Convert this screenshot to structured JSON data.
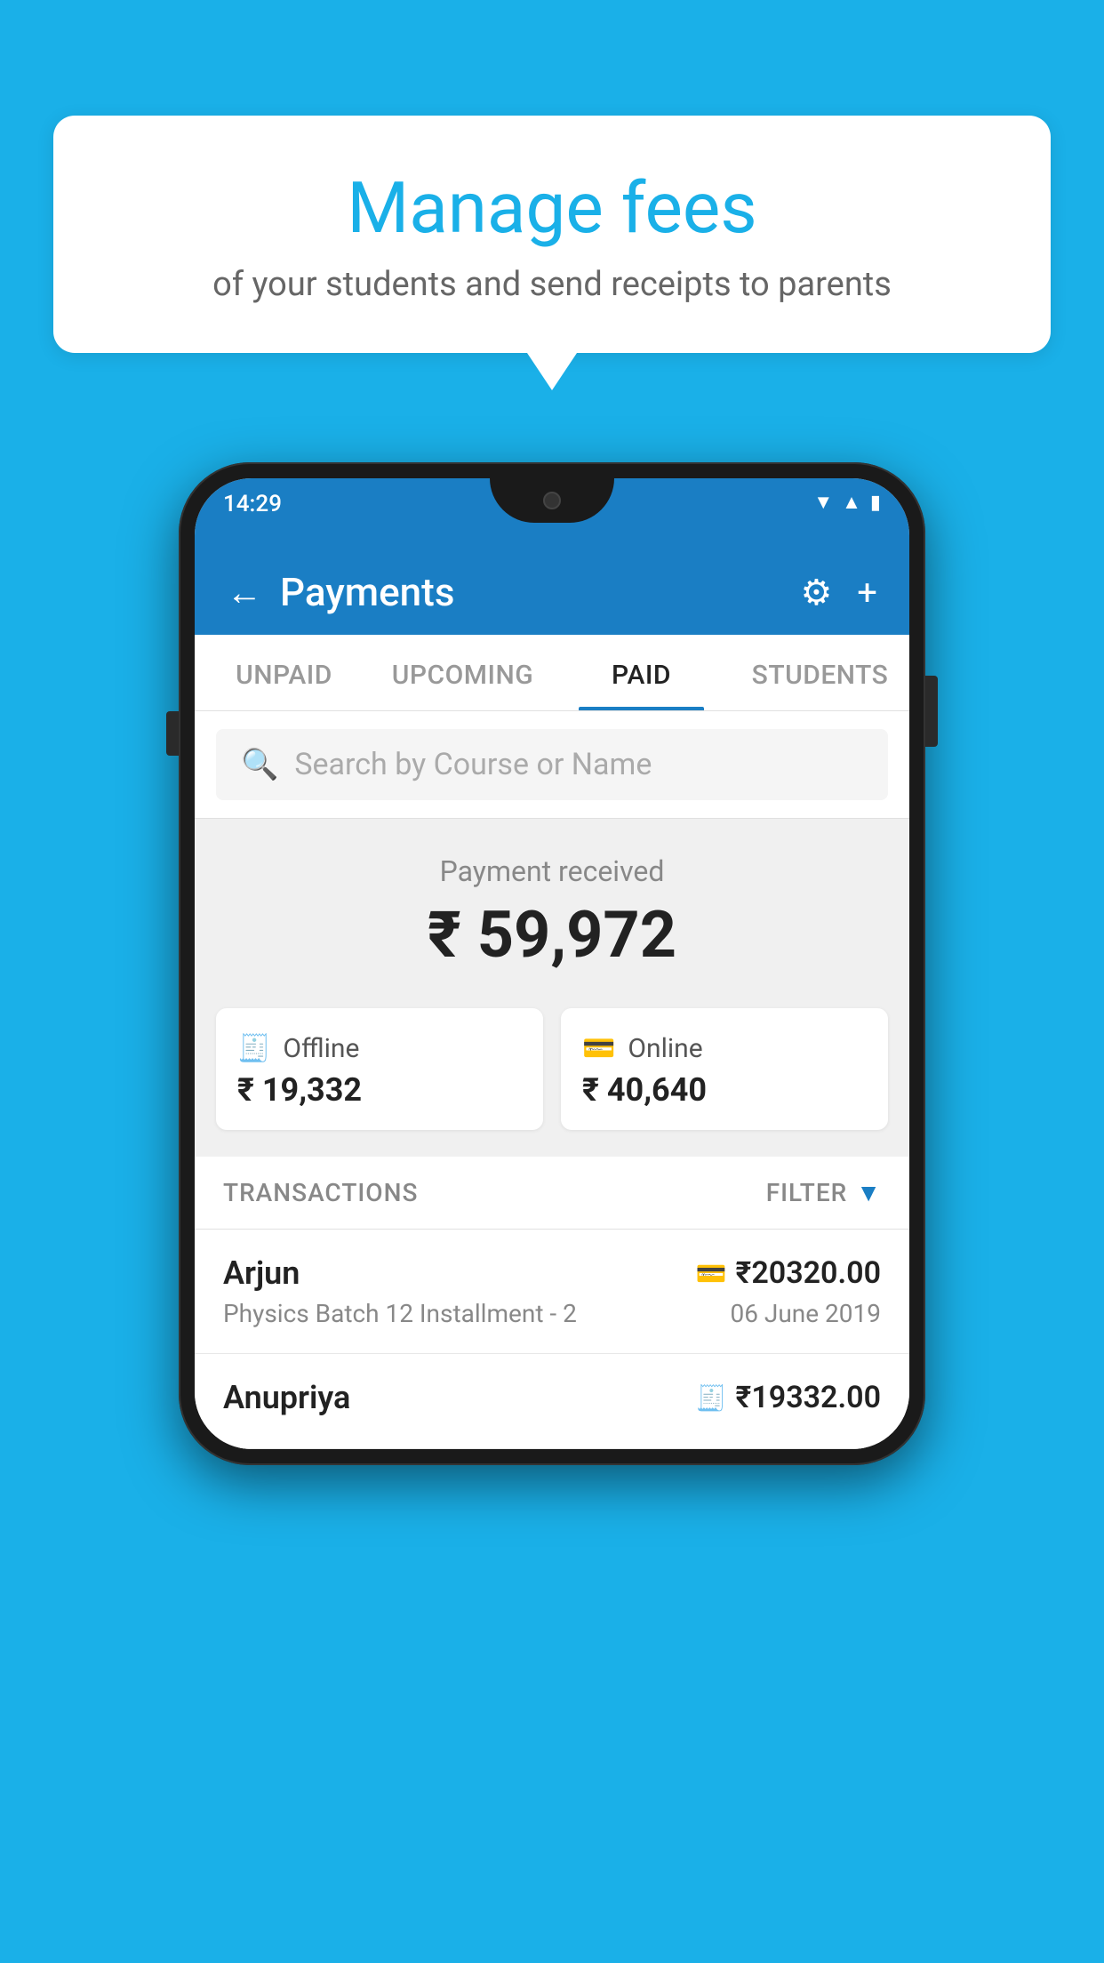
{
  "background_color": "#1ab0e8",
  "speech_bubble": {
    "title": "Manage fees",
    "subtitle": "of your students and send receipts to parents"
  },
  "phone": {
    "status_bar": {
      "time": "14:29"
    },
    "header": {
      "title": "Payments",
      "back_label": "←",
      "settings_icon": "⚙",
      "add_icon": "+"
    },
    "tabs": [
      {
        "label": "UNPAID",
        "active": false
      },
      {
        "label": "UPCOMING",
        "active": false
      },
      {
        "label": "PAID",
        "active": true
      },
      {
        "label": "STUDENTS",
        "active": false
      }
    ],
    "search": {
      "placeholder": "Search by Course or Name"
    },
    "payment_received": {
      "label": "Payment received",
      "amount": "₹ 59,972",
      "cards": [
        {
          "icon": "🧾",
          "type": "Offline",
          "amount": "₹ 19,332"
        },
        {
          "icon": "💳",
          "type": "Online",
          "amount": "₹ 40,640"
        }
      ]
    },
    "transactions": {
      "section_label": "TRANSACTIONS",
      "filter_label": "FILTER",
      "items": [
        {
          "name": "Arjun",
          "payment_mode_icon": "💳",
          "amount": "₹20320.00",
          "course": "Physics Batch 12 Installment - 2",
          "date": "06 June 2019"
        },
        {
          "name": "Anupriya",
          "payment_mode_icon": "🧾",
          "amount": "₹19332.00",
          "course": "",
          "date": ""
        }
      ]
    }
  }
}
